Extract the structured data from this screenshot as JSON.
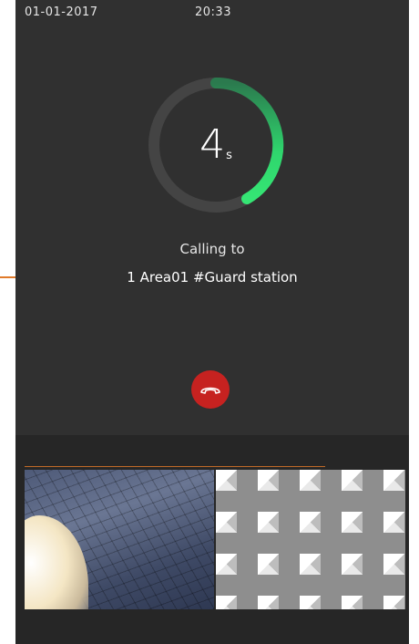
{
  "status_bar": {
    "date": "01-01-2017",
    "time": "20:33"
  },
  "call": {
    "timer_value": "4",
    "timer_unit": "s",
    "calling_label": "Calling to",
    "callee": "1 Area01 #Guard station"
  },
  "colors": {
    "background": "#303030",
    "timer_arc": "#2ede6e",
    "hangup": "#c62220",
    "annotation": "#e07a2a"
  },
  "icons": {
    "hangup": "phone-hangup-icon"
  }
}
